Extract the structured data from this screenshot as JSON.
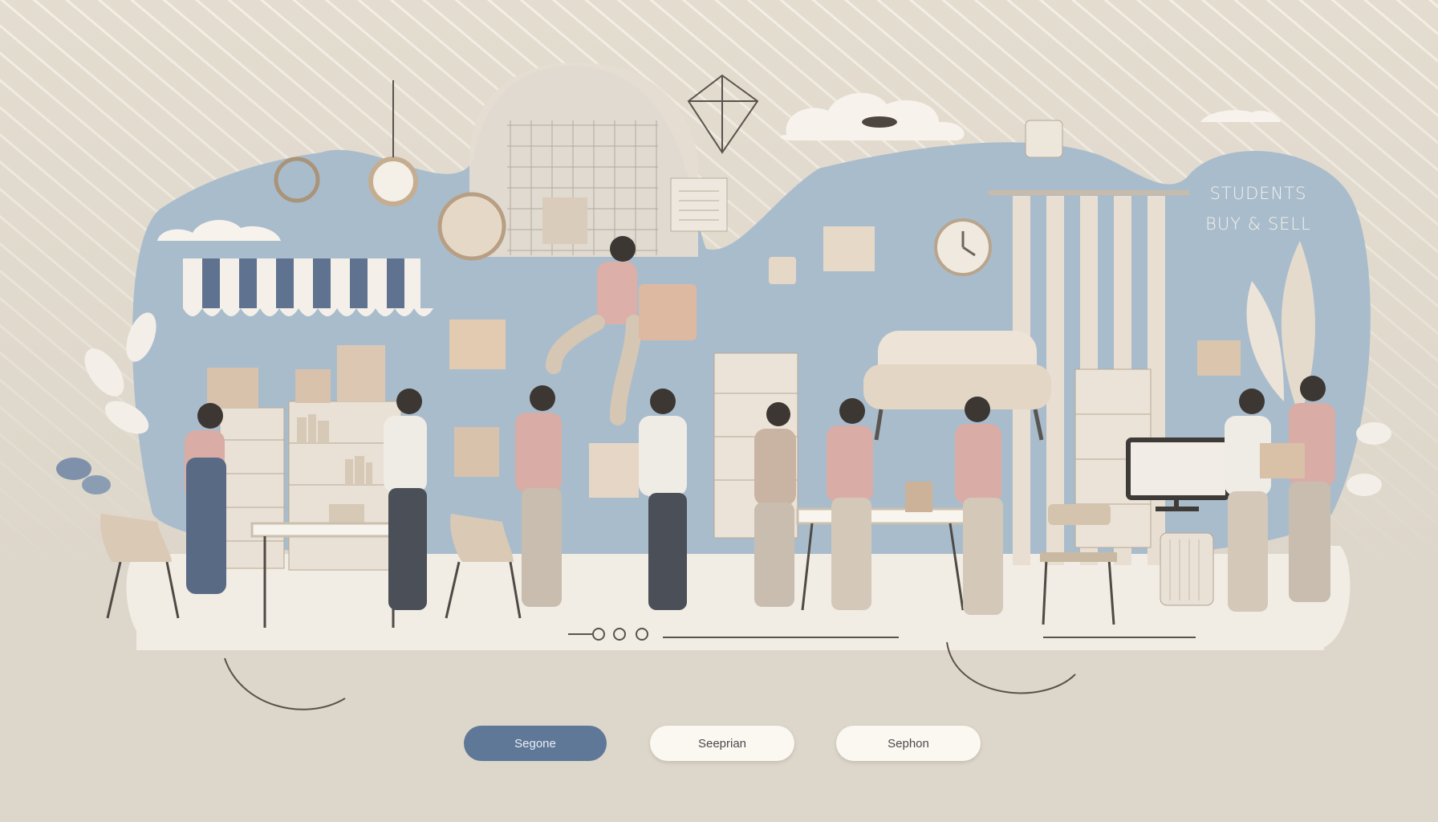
{
  "hero": {
    "line1": "STUDENTS",
    "line2": "BUY & SELL"
  },
  "tabs": [
    {
      "label": "Segone",
      "active": true
    },
    {
      "label": "Seeprian",
      "active": false
    },
    {
      "label": "Sephon",
      "active": false
    }
  ],
  "colors": {
    "background": "#ddd6ca",
    "blob": "#a9bccc",
    "floor": "#f1ece4",
    "accent_pink": "#d9a7a3",
    "accent_blue": "#5f7898",
    "beige": "#d8cbb8"
  }
}
